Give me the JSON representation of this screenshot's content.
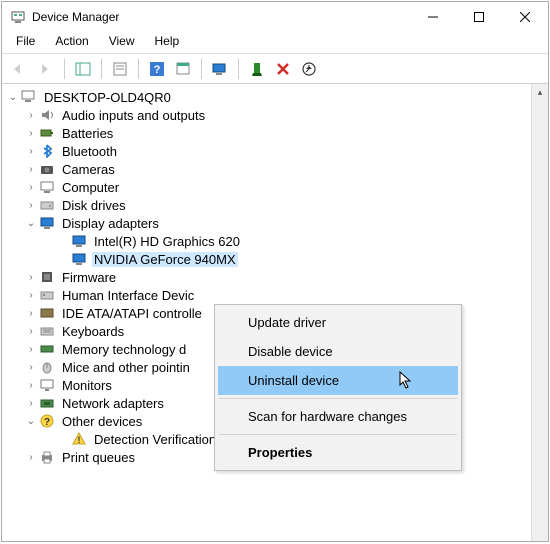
{
  "titlebar": {
    "title": "Device Manager"
  },
  "menubar": {
    "file": "File",
    "action": "Action",
    "view": "View",
    "help": "Help"
  },
  "tree": {
    "root": "DESKTOP-OLD4QR0",
    "items": [
      "Audio inputs and outputs",
      "Batteries",
      "Bluetooth",
      "Cameras",
      "Computer",
      "Disk drives",
      "Display adapters",
      "Firmware",
      "Human Interface Devic",
      "IDE ATA/ATAPI controlle",
      "Keyboards",
      "Memory technology d",
      "Mice and other pointin",
      "Monitors",
      "Network adapters",
      "Other devices",
      "Print queues"
    ],
    "display_children": [
      "Intel(R) HD Graphics 620",
      "NVIDIA GeForce 940MX"
    ],
    "other_children": [
      "Detection Verification"
    ]
  },
  "context_menu": {
    "update": "Update driver",
    "disable": "Disable device",
    "uninstall": "Uninstall device",
    "scan": "Scan for hardware changes",
    "properties": "Properties"
  }
}
